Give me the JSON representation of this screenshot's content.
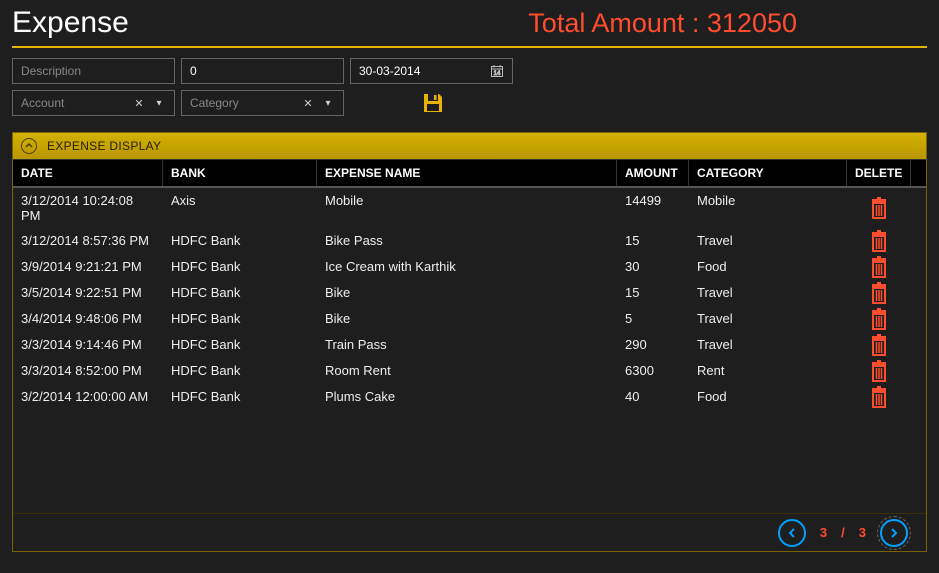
{
  "header": {
    "title": "Expense",
    "total_label": "Total Amount : 312050"
  },
  "filters": {
    "description_placeholder": "Description",
    "amount_value": "0",
    "date_value": "30-03-2014",
    "account_placeholder": "Account",
    "category_placeholder": "Category"
  },
  "panel": {
    "title": "EXPENSE DISPLAY"
  },
  "columns": {
    "date": "DATE",
    "bank": "BANK",
    "expense_name": "EXPENSE NAME",
    "amount": "AMOUNT",
    "category": "CATEGORY",
    "delete": "DELETE"
  },
  "rows": [
    {
      "date": "3/12/2014 10:24:08 PM",
      "bank": "Axis",
      "name": "Mobile",
      "amount": "14499",
      "category": "Mobile"
    },
    {
      "date": "3/12/2014 8:57:36 PM",
      "bank": "HDFC Bank",
      "name": "Bike Pass",
      "amount": "15",
      "category": "Travel"
    },
    {
      "date": "3/9/2014 9:21:21 PM",
      "bank": "HDFC Bank",
      "name": "Ice Cream with Karthik",
      "amount": "30",
      "category": "Food"
    },
    {
      "date": "3/5/2014 9:22:51 PM",
      "bank": "HDFC Bank",
      "name": "Bike",
      "amount": "15",
      "category": "Travel"
    },
    {
      "date": "3/4/2014 9:48:06 PM",
      "bank": "HDFC Bank",
      "name": "Bike",
      "amount": "5",
      "category": "Travel"
    },
    {
      "date": "3/3/2014 9:14:46 PM",
      "bank": "HDFC Bank",
      "name": "Train Pass",
      "amount": "290",
      "category": "Travel"
    },
    {
      "date": "3/3/2014 8:52:00 PM",
      "bank": "HDFC Bank",
      "name": "Room Rent",
      "amount": "6300",
      "category": "Rent"
    },
    {
      "date": "3/2/2014 12:00:00 AM",
      "bank": "HDFC Bank",
      "name": "Plums Cake",
      "amount": "40",
      "category": "Food"
    }
  ],
  "pager": {
    "current": "3",
    "separator": "/",
    "total": "3"
  },
  "colors": {
    "accent_gold": "#cca900",
    "accent_red": "#ff4d2e",
    "accent_blue": "#00a0ff"
  }
}
